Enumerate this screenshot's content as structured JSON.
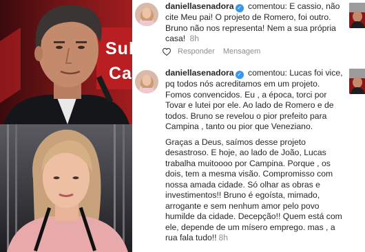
{
  "photos": {
    "top_sign_line1": "Sul",
    "top_sign_line2": "Ca"
  },
  "comments": [
    {
      "username": "daniellasenadora",
      "action": "comentou:",
      "paragraphs": [
        "E cassio, não cite Meu pai! O projeto de Romero, foi outro. Bruno não nos representa! Nem a sua própria casa!"
      ],
      "time": "8h",
      "reply_label": "Responder",
      "message_label": "Mensagem"
    },
    {
      "username": "daniellasenadora",
      "action": "comentou:",
      "paragraphs": [
        "Lucas foi vice, pq todos nós acreditamos em um projeto. Fomos convencidos. Eu , a época, torci por Tovar e lutei por ele. Ao lado de Romero e de todos. Bruno se revelou o pior prefeito para Campina , tanto ou pior que Veneziano.",
        "Graças a Deus, saímos desse projeto desastroso. E hoje, ao lado de João, Lucas trabalha muitoooo por Campina. Porque , os dois, tem a mesma visão. Compromisso com nossa amada cidade. Só olhar as obras e investimentos!! Bruno é egoísta, mimado, arrogante e sem nenhum amor pelo povo humilde da cidade. Decepção!! Quem está com ele, depende de um mísero emprego. mas , a rua fala tudo!!"
      ],
      "time": "8h"
    }
  ],
  "colors": {
    "text": "#262626",
    "muted": "#8e8e8e",
    "verified": "#3897f0",
    "background": "#ffffff"
  },
  "icons": [
    "verified-badge-icon",
    "heart-outline-icon"
  ]
}
